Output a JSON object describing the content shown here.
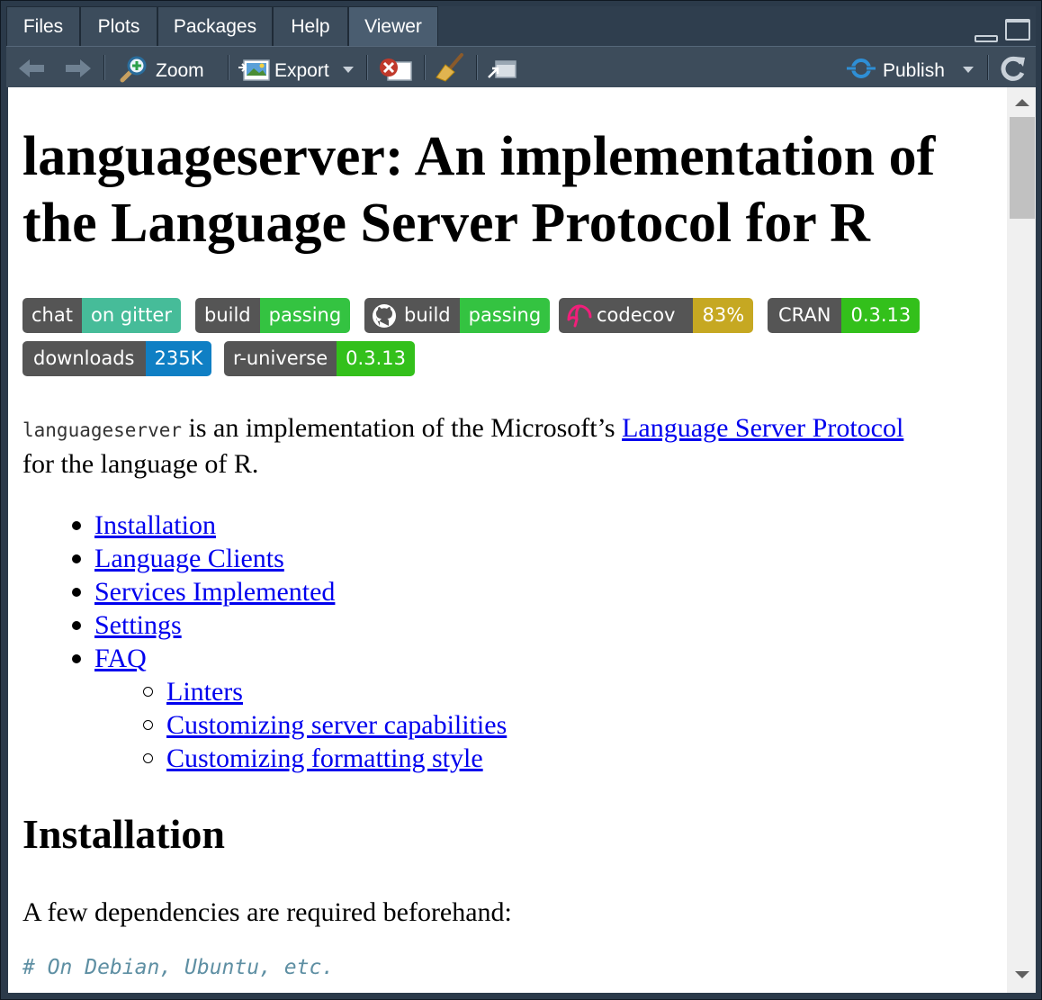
{
  "tabs": [
    {
      "label": "Files"
    },
    {
      "label": "Plots"
    },
    {
      "label": "Packages"
    },
    {
      "label": "Help"
    },
    {
      "label": "Viewer",
      "active": true
    }
  ],
  "toolbar": {
    "zoom_label": "Zoom",
    "export_label": "Export",
    "publish_label": "Publish",
    "icons": [
      "back-arrow",
      "forward-arrow",
      "zoom-magnifier",
      "export-image",
      "remove-viewer",
      "clear-broom",
      "popout-window",
      "publish-connect",
      "refresh"
    ]
  },
  "page": {
    "title": "languageserver: An implementation of the Language Server Protocol for R",
    "badges": [
      {
        "left": "chat",
        "right": "on gitter",
        "right_color": "#46bc99"
      },
      {
        "left": "build",
        "right": "passing",
        "right_color": "#34c341"
      },
      {
        "left": "build",
        "right": "passing",
        "right_color": "#34c341",
        "icon": "github"
      },
      {
        "left": "codecov",
        "right": "83%",
        "right_color": "#c6a822",
        "icon": "codecov"
      },
      {
        "left": "CRAN",
        "right": "0.3.13",
        "right_color": "#33c01b"
      },
      {
        "left": "downloads",
        "right": "235K",
        "right_color": "#0f7fc4"
      },
      {
        "left": "r-universe",
        "right": "0.3.13",
        "right_color": "#33c01b"
      }
    ],
    "intro_code": "languageserver",
    "intro_text_1": " is an implementation of the Microsoft’s ",
    "intro_link": "Language Server Protocol",
    "intro_text_2": "for the language of R.",
    "toc": [
      {
        "label": "Installation",
        "level": 1
      },
      {
        "label": "Language Clients",
        "level": 1
      },
      {
        "label": "Services Implemented",
        "level": 1
      },
      {
        "label": "Settings",
        "level": 1
      },
      {
        "label": "FAQ",
        "level": 1
      },
      {
        "label": "Linters",
        "level": 2
      },
      {
        "label": "Customizing server capabilities",
        "level": 2
      },
      {
        "label": "Customizing formatting style",
        "level": 2
      }
    ],
    "section_heading": "Installation",
    "deps_text": "A few dependencies are required beforehand:",
    "code_comment": "# On Debian, Ubuntu, etc."
  }
}
